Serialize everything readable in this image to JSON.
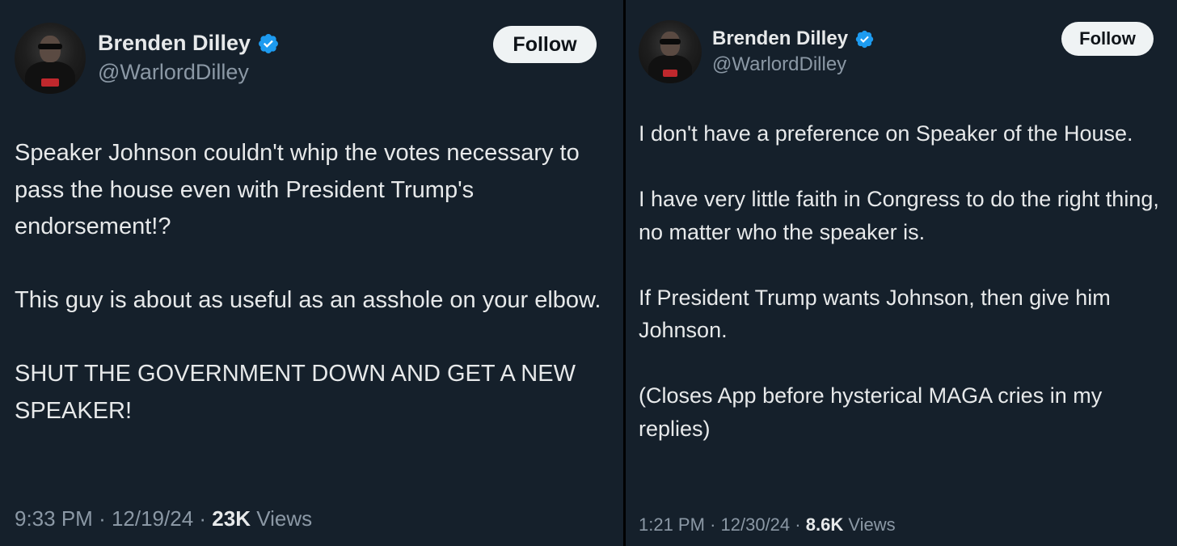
{
  "colors": {
    "background": "#15202b",
    "divider": "#000000",
    "text_primary": "#e7e9ea",
    "text_secondary": "#8b98a5",
    "verified_badge": "#1d9bf0",
    "follow_button_bg": "#eff3f4",
    "follow_button_text": "#0f1419"
  },
  "tweets": [
    {
      "author": {
        "display_name": "Brenden Dilley",
        "handle": "@WarlordDilley",
        "verified_icon": "verified-badge-icon"
      },
      "follow_label": "Follow",
      "text": "Speaker Johnson couldn't whip the votes necessary to pass the house even with President Trump's endorsement!?\n\nThis guy is about as useful as an asshole on your elbow.\n\nSHUT THE GOVERNMENT DOWN AND GET A NEW SPEAKER!",
      "time": "9:33 PM",
      "date": "12/19/24",
      "views_count": "23K",
      "views_label": "Views"
    },
    {
      "author": {
        "display_name": "Brenden Dilley",
        "handle": "@WarlordDilley",
        "verified_icon": "verified-badge-icon"
      },
      "follow_label": "Follow",
      "text": "I don't have a preference on Speaker of the House.\n\nI have very little faith in Congress to do the right thing, no matter who the speaker is.\n\nIf President Trump wants Johnson, then give him Johnson.\n\n(Closes App before hysterical MAGA cries in my replies)",
      "time": "1:21 PM",
      "date": "12/30/24",
      "views_count": "8.6K",
      "views_label": "Views"
    }
  ]
}
